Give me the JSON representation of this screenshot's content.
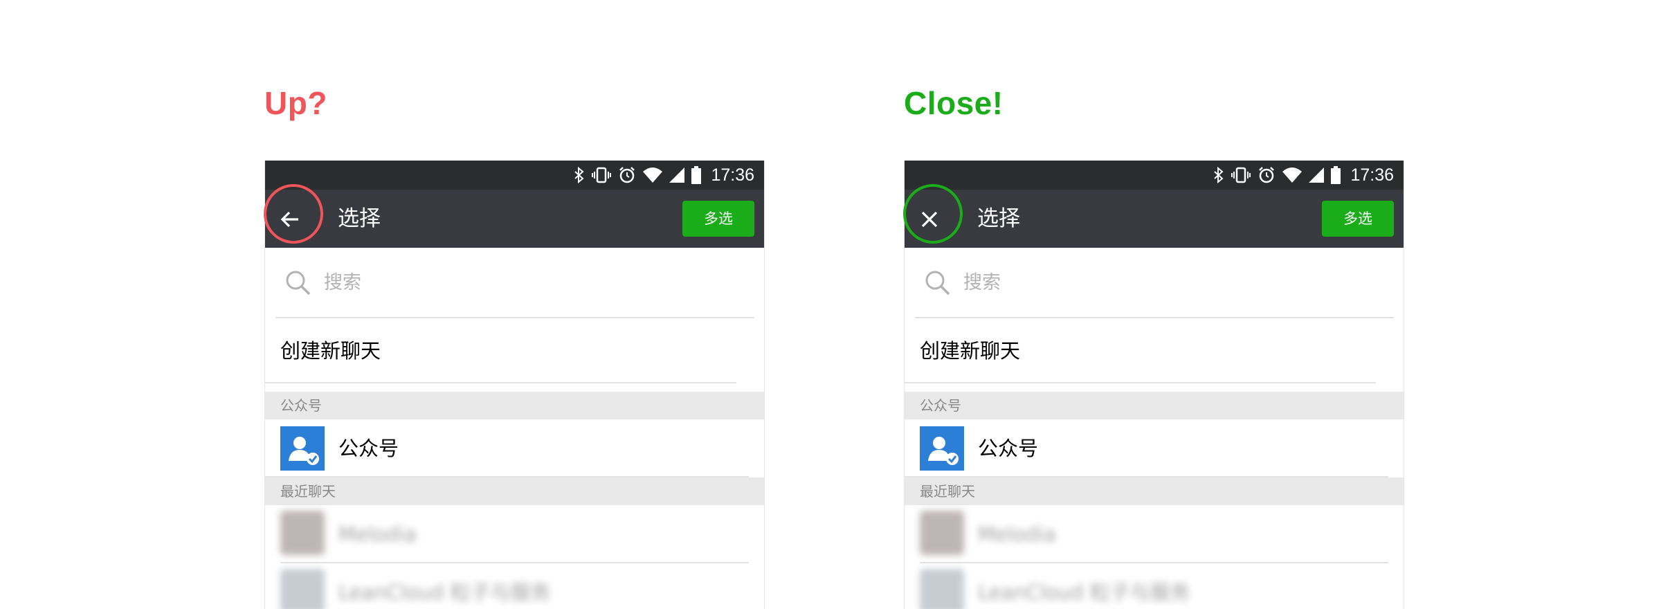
{
  "panels": [
    {
      "title": "Up?",
      "title_color": "#f0555a",
      "nav_icon": "back-arrow-icon",
      "ring_color": "#f0555a",
      "status": {
        "time": "17:36"
      },
      "appbar": {
        "title": "选择",
        "multi_select_label": "多选"
      },
      "search": {
        "placeholder": "搜索"
      },
      "create_chat_label": "创建新聊天",
      "sections": [
        {
          "header": "公众号",
          "items": [
            {
              "label": "公众号",
              "icon": "official-account-icon"
            }
          ]
        },
        {
          "header": "最近聊天",
          "items": [
            {
              "label": "Melodia"
            },
            {
              "label": "LeanCloud 粒子与服务"
            }
          ]
        }
      ]
    },
    {
      "title": "Close!",
      "title_color": "#1aad19",
      "nav_icon": "close-icon",
      "ring_color": "#1aad19",
      "status": {
        "time": "17:36"
      },
      "appbar": {
        "title": "选择",
        "multi_select_label": "多选"
      },
      "search": {
        "placeholder": "搜索"
      },
      "create_chat_label": "创建新聊天",
      "sections": [
        {
          "header": "公众号",
          "items": [
            {
              "label": "公众号",
              "icon": "official-account-icon"
            }
          ]
        },
        {
          "header": "最近聊天",
          "items": [
            {
              "label": "Melodia"
            },
            {
              "label": "LeanCloud 粒子与服务"
            }
          ]
        }
      ]
    }
  ],
  "colors": {
    "statusbar": "#2b2c2e",
    "appbar": "#393a3f",
    "accent_green": "#1aad19",
    "official_account_blue": "#2b7fd6"
  }
}
